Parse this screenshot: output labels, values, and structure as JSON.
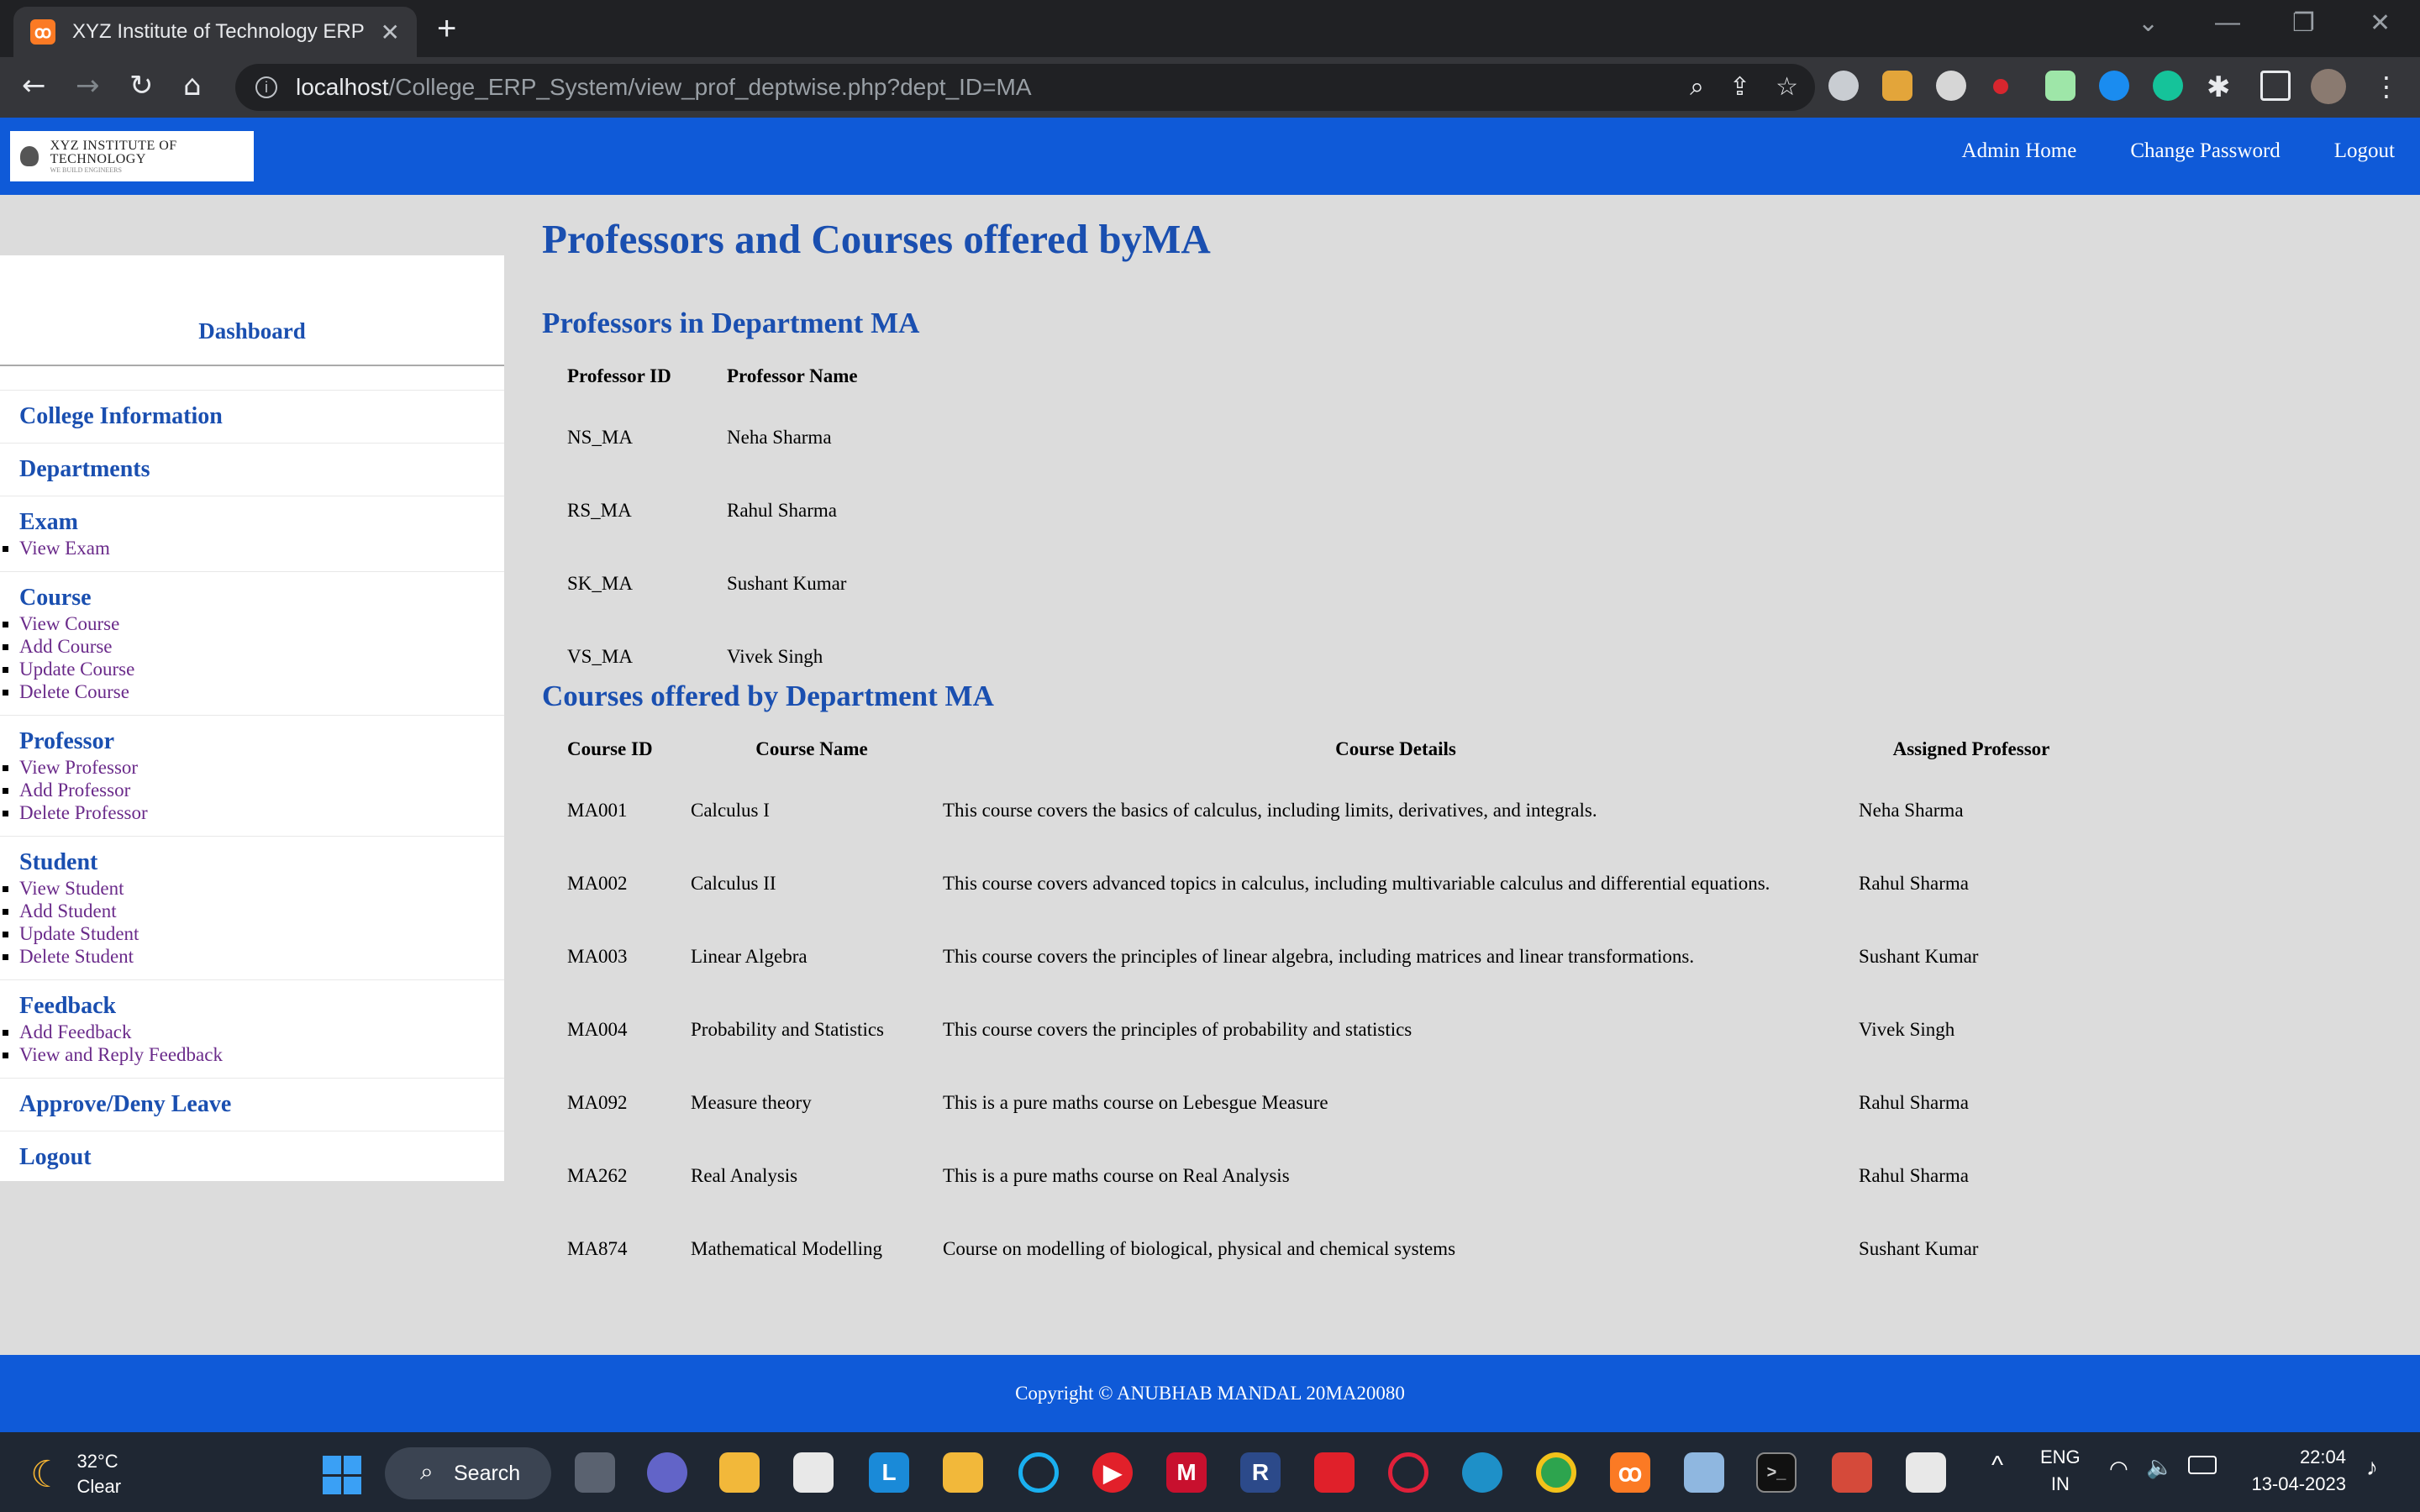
{
  "browser": {
    "tab_title": "XYZ Institute of Technology ERP",
    "tab_close": "✕",
    "new_tab": "+",
    "url_host": "localhost",
    "url_path": "/College_ERP_System/view_prof_deptwise.php?dept_ID=MA"
  },
  "header": {
    "logo_name": "XYZ INSTITUTE OF TECHNOLOGY",
    "logo_tagline": "WE BUILD ENGINEERS",
    "nav": [
      "Admin Home",
      "Change Password",
      "Logout"
    ]
  },
  "sidebar": {
    "title": "Dashboard",
    "groups": [
      {
        "title": "College Information",
        "items": []
      },
      {
        "title": "Departments",
        "items": []
      },
      {
        "title": "Exam",
        "items": [
          "View Exam"
        ]
      },
      {
        "title": "Course",
        "items": [
          "View Course",
          "Add Course",
          "Update Course",
          "Delete Course"
        ]
      },
      {
        "title": "Professor",
        "items": [
          "View Professor",
          "Add Professor",
          "Delete Professor"
        ]
      },
      {
        "title": "Student",
        "items": [
          "View Student",
          "Add Student",
          "Update Student",
          "Delete Student"
        ]
      },
      {
        "title": "Feedback",
        "items": [
          "Add Feedback",
          "View and Reply Feedback"
        ]
      },
      {
        "title": "Approve/Deny Leave",
        "items": []
      },
      {
        "title": "Logout",
        "items": []
      }
    ]
  },
  "main": {
    "title": "Professors and Courses offered byMA",
    "professors_heading": "Professors in Department MA",
    "professors_columns": [
      "Professor ID",
      "Professor Name"
    ],
    "professors": [
      [
        "NS_MA",
        "Neha Sharma"
      ],
      [
        "RS_MA",
        "Rahul Sharma"
      ],
      [
        "SK_MA",
        "Sushant Kumar"
      ],
      [
        "VS_MA",
        "Vivek Singh"
      ]
    ],
    "courses_heading": "Courses offered by Department MA",
    "courses_columns": [
      "Course ID",
      "Course Name",
      "Course Details",
      "Assigned Professor"
    ],
    "courses": [
      [
        "MA001",
        "Calculus I",
        "This course covers the basics of calculus, including limits, derivatives, and integrals.",
        "Neha Sharma"
      ],
      [
        "MA002",
        "Calculus II",
        "This course covers advanced topics in calculus, including multivariable calculus and differential equations.",
        "Rahul Sharma"
      ],
      [
        "MA003",
        "Linear Algebra",
        "This course covers the principles of linear algebra, including matrices and linear transformations.",
        "Sushant Kumar"
      ],
      [
        "MA004",
        "Probability and Statistics",
        "This course covers the principles of probability and statistics",
        "Vivek Singh"
      ],
      [
        "MA092",
        "Measure theory",
        "This is a pure maths course on Lebesgue Measure",
        "Rahul Sharma"
      ],
      [
        "MA262",
        "Real Analysis",
        "This is a pure maths course on Real Analysis",
        "Rahul Sharma"
      ],
      [
        "MA874",
        "Mathematical Modelling",
        "Course on modelling of biological, physical and chemical systems",
        "Sushant Kumar"
      ]
    ]
  },
  "footer": {
    "text": "Copyright © ANUBHAB MANDAL 20MA20080"
  },
  "taskbar": {
    "temperature": "32°C",
    "condition": "Clear",
    "search_label": "Search",
    "lang_top": "ENG",
    "lang_bottom": "IN",
    "time": "22:04",
    "date": "13-04-2023"
  },
  "colors": {
    "brand_blue": "#0f5ad8",
    "heading_blue": "#1a4fb0",
    "link_purple": "#6a2a8a"
  }
}
